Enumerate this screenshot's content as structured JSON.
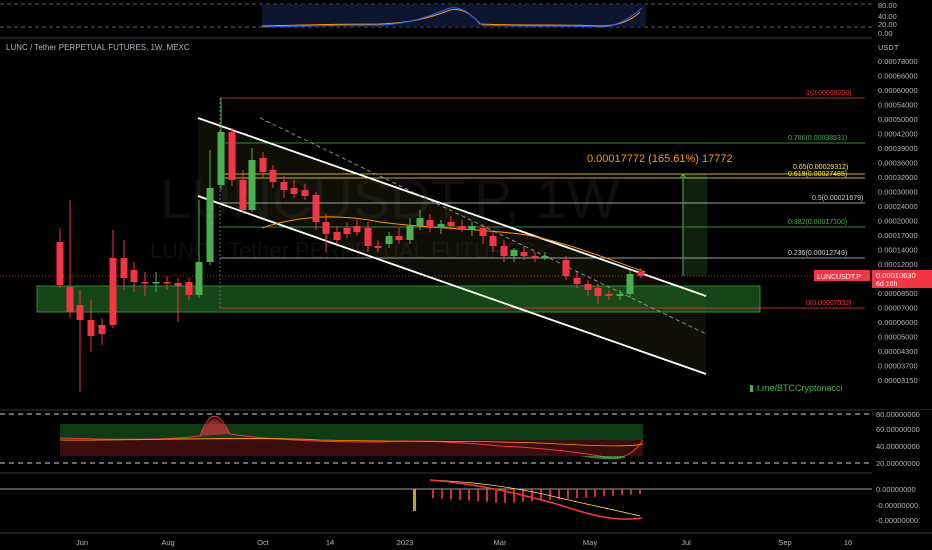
{
  "header": {
    "symbol_title": "LUNC / Tether PERPETUAL FUTURES, 1W, MEXC"
  },
  "watermark": {
    "main": "LUNCUSDT.P, 1W",
    "sub": "LUNC / Tether PERPETUAL FUTURES"
  },
  "price_axis": {
    "currency": "USDT",
    "ticks": [
      "0.00078000",
      "0.00066000",
      "0.00060000",
      "0.00054000",
      "0.00050000",
      "0.00042000",
      "0.00039000",
      "0.00036000",
      "0.00032000",
      "0.00030000",
      "0.00024000",
      "0.00020000",
      "0.00017000",
      "0.00014000",
      "0.00012000",
      "0.00010000",
      "0.00008500",
      "0.00007000",
      "0.00006000",
      "0.00005000",
      "0.00004300",
      "0.00003700",
      "0.00003150"
    ]
  },
  "price_badge": {
    "symbol": "LUNCUSDT.P",
    "price": "0.00010630",
    "countdown": "6d 16h"
  },
  "fibonacci": {
    "levels": [
      {
        "label": "1(0.00059250)",
        "color": "#f23645"
      },
      {
        "label": "0.786(0.00038531)",
        "color": "#4caf50"
      },
      {
        "label": "0.65(0.00029312)",
        "color": "#ffeb3b"
      },
      {
        "label": "0.618(0.00027485)",
        "color": "#ffeb3b"
      },
      {
        "label": "0.5(0.00021679)",
        "color": "#d1d4dc"
      },
      {
        "label": "0.382(0.00017100)",
        "color": "#4caf50"
      },
      {
        "label": "0.236(0.00012749)",
        "color": "#d1d4dc"
      },
      {
        "label": "0(0.00007932)",
        "color": "#f23645"
      }
    ]
  },
  "measure": {
    "label": "0.00017772 (165.61%) 17772"
  },
  "link_label": "t.me/BTCCryptonacci",
  "time_axis": {
    "labels": [
      "Jun",
      "Aug",
      "Oct",
      "14",
      "2023",
      "Mar",
      "May",
      "Jul",
      "Sep",
      "16"
    ]
  },
  "stoch_panel": {
    "ticks": [
      "80.00",
      "40.00",
      "20.00",
      "0.00"
    ]
  },
  "rsi_panel": {
    "ticks": [
      "80.00000000",
      "60.00000000",
      "40.00000000",
      "20.00000000"
    ]
  },
  "macd_panel": {
    "ticks": [
      "0.00000000",
      "-0.00000000",
      "-0.00000000"
    ]
  },
  "colors": {
    "up": "#26a69a",
    "up_candle": "#4caf50",
    "down": "#f23645",
    "support_zone": "#2e7d32",
    "channel": "#ffffff",
    "orange": "#ff9800"
  }
}
